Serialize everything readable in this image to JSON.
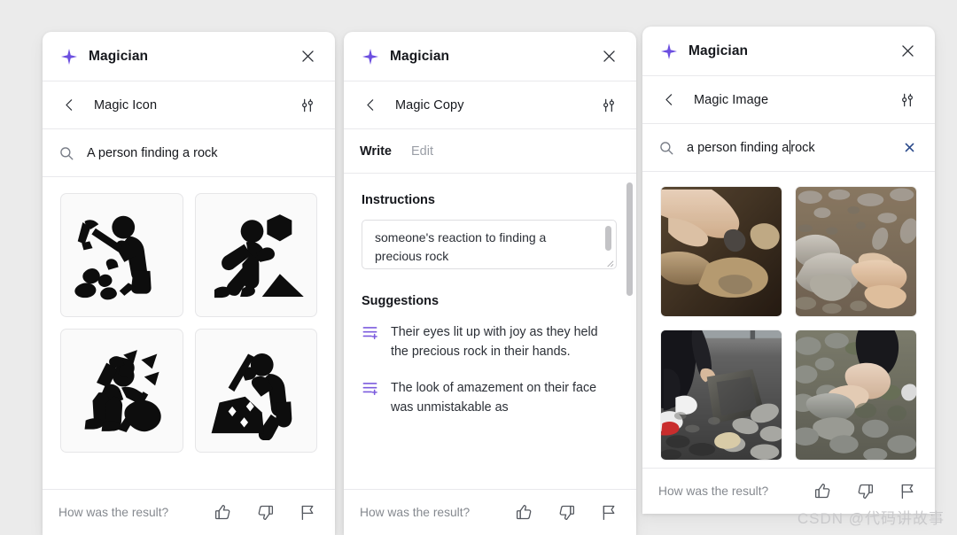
{
  "background_color": "#ebebeb",
  "accent_color": "#7c5cde",
  "panels": [
    {
      "id": "magic-icon",
      "app_title": "Magician",
      "nav_title": "Magic Icon",
      "search_value": "A person finding a rock",
      "footer_label": "How was the result?",
      "icons": [
        {
          "name": "miner-with-pickaxe-icon",
          "alt": "person swinging a pickaxe at rocks"
        },
        {
          "name": "person-reaching-hex-rock-icon",
          "alt": "person reaching toward a hexagonal rock"
        },
        {
          "name": "person-striking-rock-sparks-icon",
          "alt": "person striking a rock with sparks flying"
        },
        {
          "name": "person-chiseling-gem-rock-icon",
          "alt": "person chiseling a rock containing gems"
        }
      ]
    },
    {
      "id": "magic-copy",
      "app_title": "Magician",
      "nav_title": "Magic Copy",
      "tabs": [
        {
          "label": "Write",
          "active": true
        },
        {
          "label": "Edit",
          "active": false
        }
      ],
      "instructions_label": "Instructions",
      "instructions_value": "someone's reaction to finding a precious rock",
      "suggestions_label": "Suggestions",
      "suggestions": [
        "Their eyes lit up with joy as they held the precious rock in their hands.",
        "The look of amazement on their face was unmistakable as"
      ],
      "footer_label": "How was the result?"
    },
    {
      "id": "magic-image",
      "app_title": "Magician",
      "nav_title": "Magic Image",
      "search_value": "a person finding a",
      "search_value_tail": "rock",
      "footer_label": "How was the result?",
      "images": [
        {
          "name": "photo-hand-tan-rocks",
          "alt": "hand reaching toward tan rocks"
        },
        {
          "name": "photo-hand-gray-rock-gravel",
          "alt": "hand pointing at a gray rock on gravel"
        },
        {
          "name": "photo-person-lifting-dark-rock",
          "alt": "person in dark pants lifting a large dark rock"
        },
        {
          "name": "photo-hand-picking-gray-stone",
          "alt": "gloved hand picking up a gray stone"
        }
      ]
    }
  ],
  "footer_icons": [
    {
      "name": "thumbs-up-icon"
    },
    {
      "name": "thumbs-down-icon"
    },
    {
      "name": "flag-icon"
    }
  ],
  "watermark": "CSDN @代码讲故事"
}
